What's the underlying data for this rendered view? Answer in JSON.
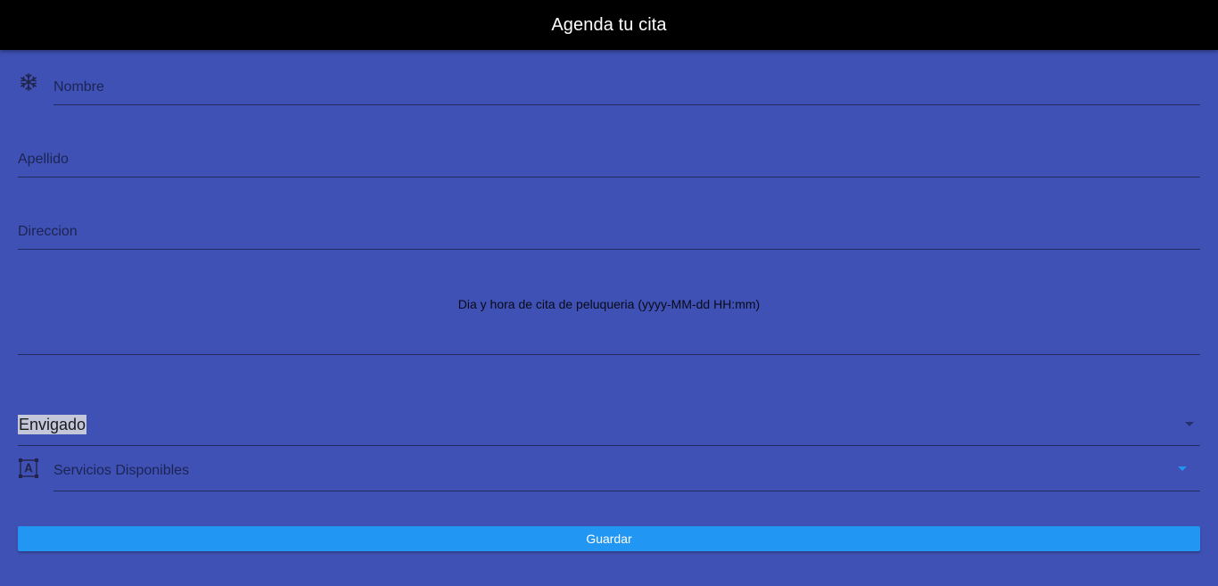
{
  "appbar": {
    "title": "Agenda tu cita"
  },
  "form": {
    "nombre": {
      "placeholder": "Nombre",
      "value": "",
      "icon": "snowflake-icon"
    },
    "apellido": {
      "placeholder": "Apellido",
      "value": ""
    },
    "direccion": {
      "placeholder": "Direccion",
      "value": ""
    },
    "fecha_hora": {
      "label": "Dia y hora de cita de peluqueria (yyyy-MM-dd HH:mm)"
    },
    "ciudad": {
      "selected": "Envigado"
    },
    "servicios": {
      "placeholder": "Servicios Disponibles",
      "icon": "text-box-icon"
    },
    "save_label": "Guardar"
  },
  "colors": {
    "background": "#3f51b5",
    "appbar": "#000000",
    "button": "#2196f3",
    "dropdown_arrow_accent": "#2196f3"
  }
}
